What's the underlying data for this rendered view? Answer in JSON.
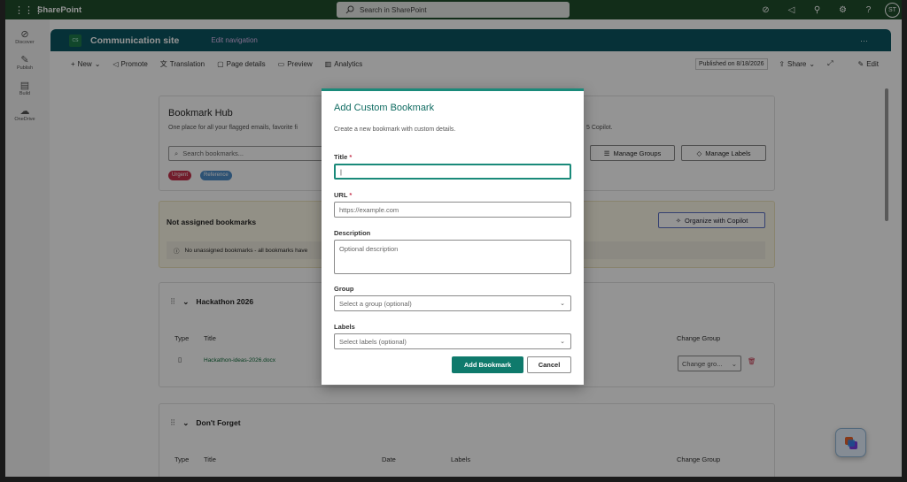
{
  "suitebar": {
    "app_name": "SharePoint",
    "search_placeholder": "Search in SharePoint",
    "user_initials": "ST"
  },
  "rail": {
    "items": [
      {
        "label": "Discover"
      },
      {
        "label": "Publish"
      },
      {
        "label": "Build"
      },
      {
        "label": "OneDrive"
      }
    ]
  },
  "site": {
    "logo_text": "CS",
    "title": "Communication site",
    "edit_nav": "Edit navigation"
  },
  "cmdbar": {
    "new": "New",
    "promote": "Promote",
    "translation": "Translation",
    "page_details": "Page details",
    "preview": "Preview",
    "analytics": "Analytics",
    "published": "Published on 8/18/2026",
    "share": "Share",
    "edit": "Edit"
  },
  "hub": {
    "title": "Bookmark Hub",
    "desc": "One place for all your flagged emails, favorite fi",
    "desc_right": "5 Copilot.",
    "search_placeholder": "Search bookmarks...",
    "tags": [
      "Urgent",
      "Reference"
    ],
    "manage_groups": "Manage Groups",
    "manage_labels": "Manage Labels"
  },
  "unassigned": {
    "title": "Not assigned bookmarks",
    "organize": "Organize with Copilot",
    "info": "No unassigned bookmarks - all bookmarks have"
  },
  "group1": {
    "name": "Hackathon 2026",
    "headers": {
      "type": "Type",
      "title": "Title",
      "change": "Change Group"
    },
    "row": {
      "title": "Hackathon-ideas-2026.docx",
      "change": "Change gro..."
    }
  },
  "group2": {
    "name": "Don't Forget",
    "headers": {
      "type": "Type",
      "title": "Title",
      "date": "Date",
      "labels": "Labels",
      "change": "Change Group"
    }
  },
  "dialog": {
    "title": "Add Custom Bookmark",
    "subtitle": "Create a new bookmark with custom details.",
    "title_label": "Title",
    "url_label": "URL",
    "url_placeholder": "https://example.com",
    "desc_label": "Description",
    "desc_placeholder": "Optional description",
    "group_label": "Group",
    "group_placeholder": "Select a group (optional)",
    "labels_label": "Labels",
    "labels_placeholder": "Select labels (optional)",
    "submit": "Add Bookmark",
    "cancel": "Cancel",
    "required_mark": "*"
  },
  "colors": {
    "suitebar": "#1f4e2c",
    "site_header": "#0c5561",
    "accent": "#0f7a6c",
    "tag_urgent": "#c4314b",
    "tag_reference": "#4f8ec9"
  }
}
